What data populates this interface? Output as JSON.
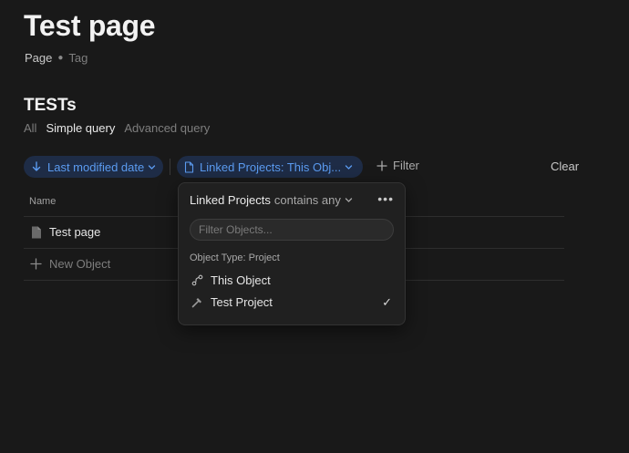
{
  "page": {
    "title": "Test page",
    "type_label": "Page",
    "tag_label": "Tag"
  },
  "set": {
    "title": "TESTs",
    "views": [
      {
        "label": "All",
        "active": false
      },
      {
        "label": "Simple query",
        "active": true
      },
      {
        "label": "Advanced query",
        "active": false
      }
    ]
  },
  "toolbar": {
    "sort_label": "Last modified date",
    "linked_filter_label": "Linked Projects: This Obj...",
    "filter_label": "Filter",
    "clear_label": "Clear"
  },
  "table": {
    "column_name": "Name",
    "rows": [
      {
        "name": "Test page"
      }
    ],
    "new_object_label": "New Object"
  },
  "popup": {
    "field": "Linked Projects",
    "operator": "contains any",
    "search_placeholder": "Filter Objects...",
    "group_label": "Object Type: Project",
    "items": [
      {
        "label": "This Object",
        "icon": "relation-icon",
        "checked": false
      },
      {
        "label": "Test Project",
        "icon": "hammer-icon",
        "checked": true
      }
    ],
    "check_glyph": "✓"
  },
  "colors": {
    "background": "#191919",
    "pill_bg": "#1e2c46",
    "accent": "#5b9bf0"
  }
}
